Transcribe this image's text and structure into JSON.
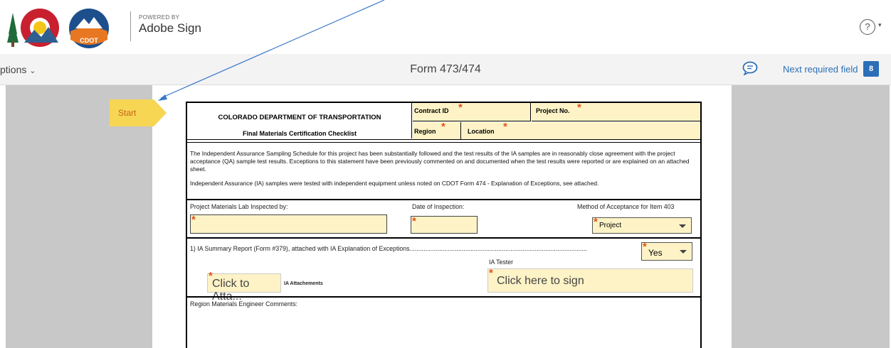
{
  "header": {
    "powered_by": "POWERED BY",
    "product": "Adobe Sign",
    "cdot_logo_text": "CDOT",
    "help_label": "?"
  },
  "toolbar": {
    "options_label": "ptions",
    "document_title": "Form 473/474",
    "next_required_label": "Next required field",
    "next_required_count": "8"
  },
  "start_tab": {
    "label": "Start"
  },
  "form": {
    "agency": "COLORADO DEPARTMENT OF TRANSPORTATION",
    "form_title": "Final Materials Certification Checklist",
    "contract_id_label": "Contract ID",
    "project_no_label": "Project No.",
    "region_label": "Region",
    "location_label": "Location",
    "paragraph1": "The Independent Assurance Sampling Schedule for this project has been substantially followed and the test results of the IA samples are in reasonably close agreement with the project acceptance (QA) sample test results.  Exceptions to this statement have been previously commented on and documented when the test results were reported or are explained on an attached sheet.",
    "paragraph2": "Independent Assurance (IA) samples were tested with independent equipment unless noted on CDOT Form 474 - Explanation of Exceptions, see attached.",
    "lab_inspected_label": "Project Materials Lab Inspected by:",
    "date_inspection_label": "Date of Inspection:",
    "method_label": "Method of Acceptance for Item 403",
    "method_value": "Project",
    "ia_summary_label": "1) IA Summary Report (Form #379), attached with IA Explanation of Exceptions......................................................................................................",
    "ia_summary_value": "Yes",
    "ia_tester_label": "IA Tester",
    "sign_placeholder": "Click here to sign",
    "attach_placeholder": "Click to Atta...",
    "attachments_label": "IA Attachements",
    "comments_label": "Region Materials Engineer Comments:",
    "required_mark": "*"
  },
  "colors": {
    "field_fill": "#fdf3c6",
    "required_star": "#e0541b",
    "link_blue": "#2b6fb8",
    "start_yellow": "#f6d653"
  }
}
